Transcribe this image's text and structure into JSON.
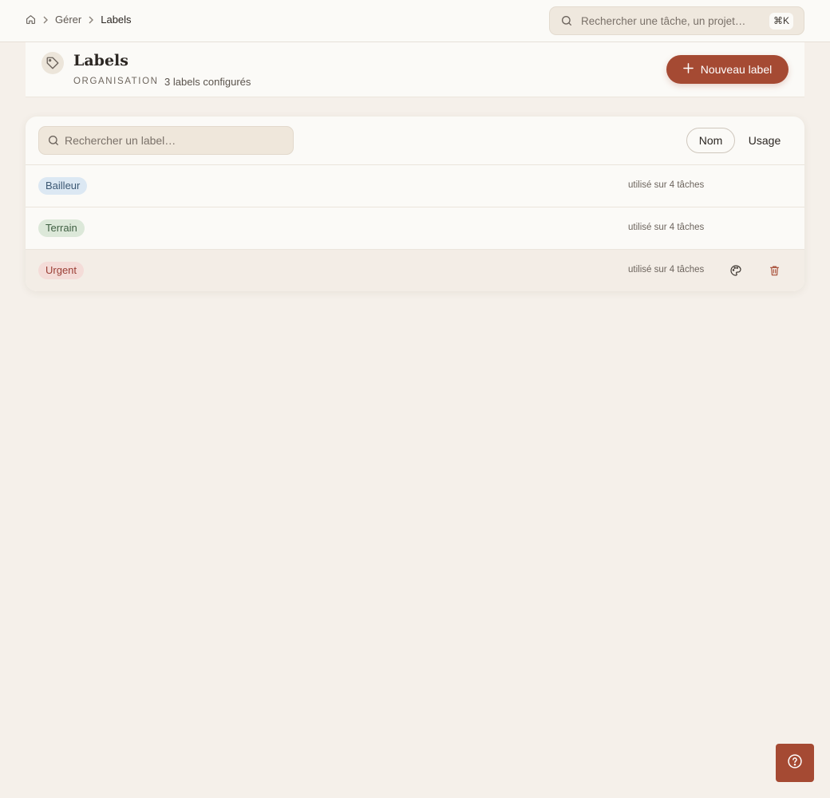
{
  "breadcrumb": {
    "items": [
      "Gérer",
      "Labels"
    ]
  },
  "global_search": {
    "placeholder": "Rechercher une tâche, un projet…",
    "shortcut": "⌘K"
  },
  "header": {
    "title": "Labels",
    "kicker": "ORGANISATION",
    "count_text": "3 labels configurés",
    "new_button_label": "Nouveau label"
  },
  "list": {
    "search_placeholder": "Rechercher un label…",
    "sort_options": [
      "Nom",
      "Usage"
    ],
    "active_sort": "Nom",
    "rows": [
      {
        "name": "Bailleur",
        "usage": "utilisé sur 4 tâches",
        "chip_bg": "#dce8f3",
        "chip_fg": "#3c5873"
      },
      {
        "name": "Terrain",
        "usage": "utilisé sur 4 tâches",
        "chip_bg": "#dce8d9",
        "chip_fg": "#3f5f42"
      },
      {
        "name": "Urgent",
        "usage": "utilisé sur 4 tâches",
        "chip_bg": "#f4dcd8",
        "chip_fg": "#9b3f36"
      }
    ]
  },
  "icons": {
    "home": "home-icon",
    "chevron": "chevron-right-icon",
    "search": "search-icon",
    "tag": "tag-icon",
    "plus": "plus-icon",
    "palette": "palette-icon",
    "trash": "trash-icon",
    "help": "help-circle-icon"
  },
  "colors": {
    "accent": "#a54a33",
    "background": "#f5f0ea",
    "surface": "#fbfaf7"
  }
}
